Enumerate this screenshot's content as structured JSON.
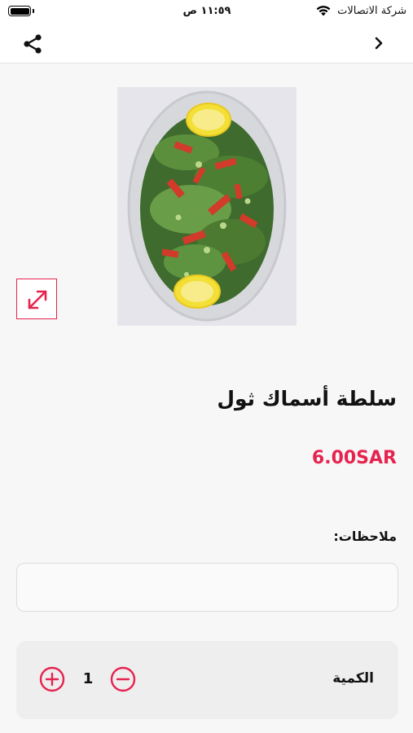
{
  "status_bar": {
    "time": "١١:٥٩ ص",
    "carrier": "شركة الاتصالات"
  },
  "nav": {
    "share_icon": "share-icon",
    "back_icon": "chevron-right-icon"
  },
  "product": {
    "image_icon": "salad-photo",
    "expand_icon": "expand-icon",
    "title": "سلطة أسماك ثول",
    "price": "6.00SAR"
  },
  "notes": {
    "label": "ملاحظات:",
    "value": "",
    "placeholder": ""
  },
  "quantity": {
    "label": "الكمية",
    "value": "1",
    "plus_icon": "plus-circle-icon",
    "minus_icon": "minus-circle-icon"
  },
  "colors": {
    "accent": "#e6234f",
    "background": "#f7f7f7",
    "card": "#eeeeef"
  }
}
